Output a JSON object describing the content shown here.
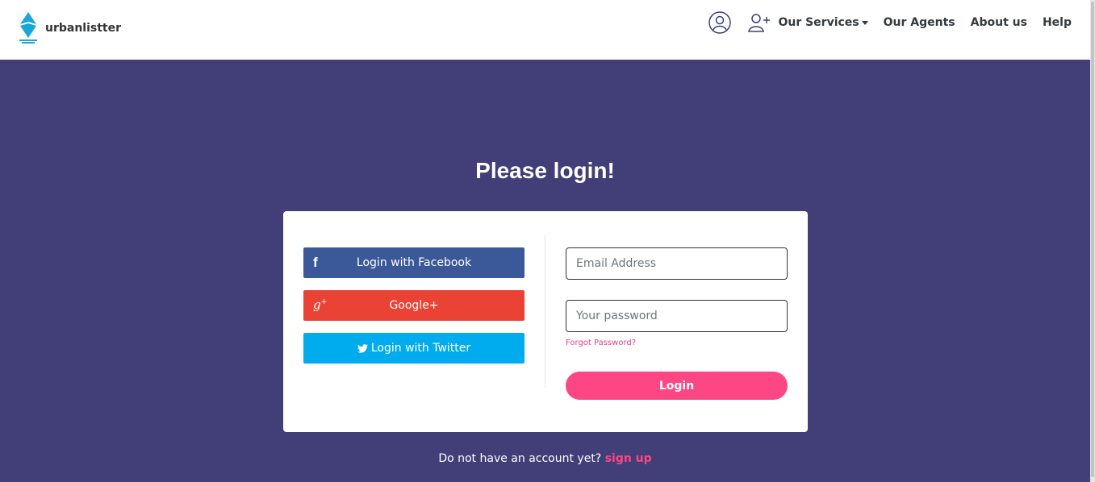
{
  "brand": {
    "name": "urbanlistter",
    "logo_icon": "diamond-logo-icon",
    "logo_color": "#1aa7d8"
  },
  "nav": {
    "account_icon": "user-circle-icon",
    "add_user_icon": "user-plus-icon",
    "services_label": "Our Services",
    "agents_label": "Our Agents",
    "about_label": "About us",
    "help_label": "Help"
  },
  "page": {
    "title": "Please login!",
    "background": "#423e78"
  },
  "social": {
    "facebook": {
      "label": "Login with Facebook",
      "icon": "facebook-icon",
      "color": "#3b5998"
    },
    "google": {
      "label": "Google+",
      "icon": "google-plus-icon",
      "color": "#ea4335"
    },
    "twitter": {
      "label": "Login with Twitter",
      "icon": "twitter-icon",
      "color": "#00acee"
    }
  },
  "form": {
    "email_placeholder": "Email Address",
    "password_placeholder": "Your password",
    "forgot_label": "Forgot Password?",
    "login_label": "Login",
    "accent": "#fd4784"
  },
  "signup": {
    "prompt": "Do not have an account yet?",
    "link_label": "sign up"
  }
}
